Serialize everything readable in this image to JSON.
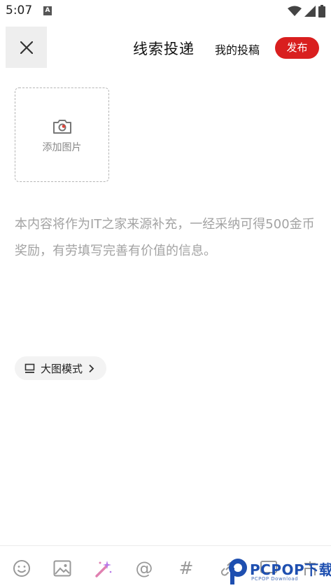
{
  "status_bar": {
    "time": "5:07",
    "notification_letter": "A"
  },
  "header": {
    "title": "线索投递",
    "my_posts": "我的投稿",
    "publish": "发布"
  },
  "add_image": {
    "label": "添加图片"
  },
  "hint": "本内容将作为IT之家来源补充，一经采纳可得500金币奖励，有劳填写完善有价值的信息。",
  "big_mode": {
    "label": "大图模式"
  },
  "toolbar": {
    "icons": [
      "emoji-icon",
      "image-icon",
      "magic-wand-icon",
      "at-icon",
      "hashtag-icon",
      "link-icon",
      "screen-icon",
      "more-icon"
    ],
    "at_glyph": "@",
    "hash_glyph": "#"
  },
  "watermark": {
    "text": "PCPOP下载",
    "sub": "PCPOP Download"
  },
  "colors": {
    "accent": "#d91f1f",
    "hint_text": "#a3a3a3"
  }
}
